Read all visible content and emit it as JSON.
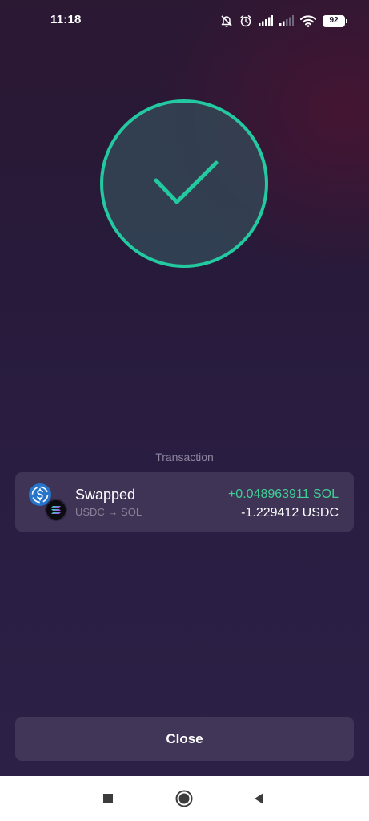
{
  "status_bar": {
    "time": "11:18",
    "battery": "92",
    "icons": [
      "mute-icon",
      "alarm-icon",
      "signal-icon",
      "signal-weak-icon",
      "wifi-icon",
      "battery-icon"
    ]
  },
  "success": {
    "icon": "checkmark-icon",
    "accent_color": "#23c9a0"
  },
  "transaction": {
    "section_label": "Transaction",
    "title": "Swapped",
    "subtitle": "USDC → SOL",
    "amount_in": "+0.048963911 SOL",
    "amount_out": "-1.229412 USDC",
    "amount_in_color": "#3ecf96",
    "icons": [
      "usdc-coin-icon",
      "sol-coin-icon"
    ]
  },
  "actions": {
    "close_label": "Close"
  },
  "nav_bar": {
    "icons": [
      "recents-icon",
      "home-icon",
      "back-icon"
    ]
  }
}
